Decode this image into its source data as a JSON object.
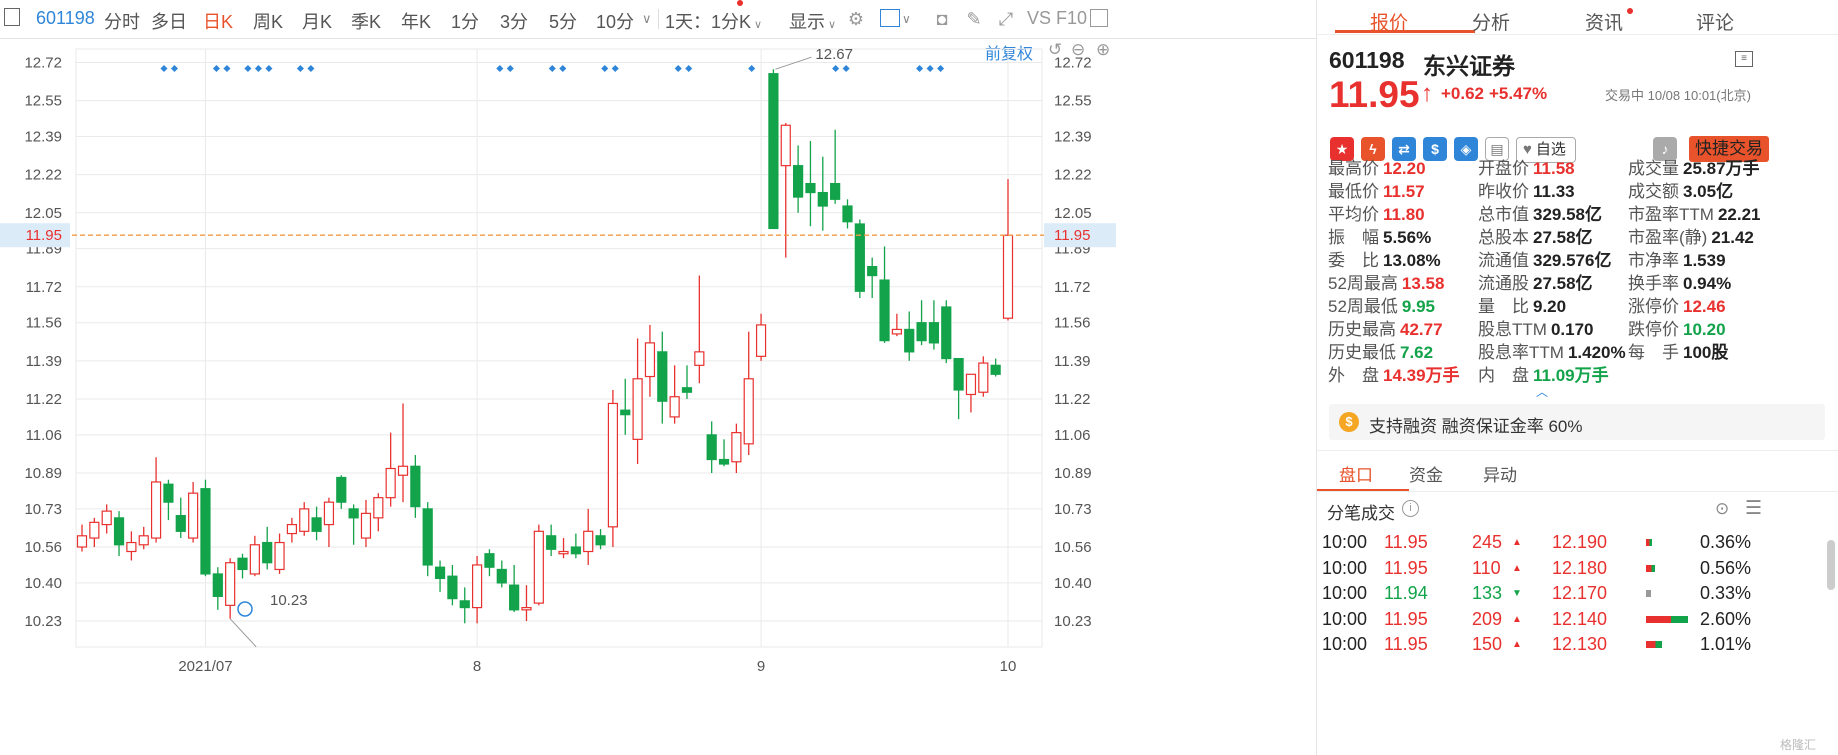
{
  "toolbar": {
    "code": "601198",
    "periods": [
      "分时",
      "多日",
      "日K",
      "周K",
      "月K",
      "季K",
      "年K",
      "1分",
      "3分",
      "5分",
      "10分"
    ],
    "active_period": "日K",
    "interval_select": "1天：1分K",
    "display_label": "显示",
    "vs_label": "VS",
    "f10_label": "F10",
    "rights_label": "前复权"
  },
  "chart": {
    "current_price_tag": "11.95",
    "high_annotation": "12.67",
    "low_annotation": "10.23",
    "y_ticks": [
      "12.72",
      "12.55",
      "12.39",
      "12.22",
      "12.05",
      "11.89",
      "11.72",
      "11.56",
      "11.39",
      "11.22",
      "11.06",
      "10.89",
      "10.73",
      "10.56",
      "10.40",
      "10.23"
    ],
    "x_labels": [
      "2021/07",
      "8",
      "9",
      "10"
    ],
    "colors": {
      "up": "#e8312e",
      "down": "#13a34a",
      "current_line": "#f39a44",
      "grid": "#eaeaea",
      "marker": "#2f86d9"
    }
  },
  "chart_data": {
    "type": "candlestick",
    "ylim": [
      10.15,
      12.78
    ],
    "candles": [
      [
        10.56,
        10.61,
        10.54,
        10.66
      ],
      [
        10.6,
        10.67,
        10.56,
        10.69
      ],
      [
        10.66,
        10.72,
        10.62,
        10.75
      ],
      [
        10.69,
        10.57,
        10.52,
        10.72
      ],
      [
        10.54,
        10.58,
        10.5,
        10.63
      ],
      [
        10.57,
        10.61,
        10.55,
        10.65
      ],
      [
        10.6,
        10.85,
        10.58,
        10.96
      ],
      [
        10.84,
        10.76,
        10.68,
        10.86
      ],
      [
        10.7,
        10.63,
        10.6,
        10.78
      ],
      [
        10.6,
        10.8,
        10.58,
        10.85
      ],
      [
        10.82,
        10.44,
        10.43,
        10.86
      ],
      [
        10.44,
        10.34,
        10.28,
        10.47
      ],
      [
        10.3,
        10.49,
        10.24,
        10.51
      ],
      [
        10.51,
        10.46,
        10.42,
        10.53
      ],
      [
        10.44,
        10.57,
        10.43,
        10.61
      ],
      [
        10.58,
        10.49,
        10.46,
        10.65
      ],
      [
        10.46,
        10.58,
        10.44,
        10.62
      ],
      [
        10.62,
        10.66,
        10.58,
        10.69
      ],
      [
        10.63,
        10.73,
        10.61,
        10.76
      ],
      [
        10.69,
        10.63,
        10.59,
        10.74
      ],
      [
        10.66,
        10.76,
        10.56,
        10.78
      ],
      [
        10.87,
        10.76,
        10.73,
        10.88
      ],
      [
        10.73,
        10.69,
        10.57,
        10.75
      ],
      [
        10.6,
        10.71,
        10.56,
        10.77
      ],
      [
        10.69,
        10.78,
        10.63,
        10.8
      ],
      [
        10.78,
        10.91,
        10.74,
        11.07
      ],
      [
        10.88,
        10.92,
        10.76,
        11.2
      ],
      [
        10.92,
        10.74,
        10.69,
        10.97
      ],
      [
        10.73,
        10.48,
        10.43,
        10.76
      ],
      [
        10.47,
        10.42,
        10.36,
        10.5
      ],
      [
        10.43,
        10.33,
        10.3,
        10.48
      ],
      [
        10.32,
        10.29,
        10.22,
        10.38
      ],
      [
        10.29,
        10.48,
        10.22,
        10.52
      ],
      [
        10.53,
        10.47,
        10.43,
        10.55
      ],
      [
        10.46,
        10.4,
        10.38,
        10.5
      ],
      [
        10.39,
        10.28,
        10.27,
        10.48
      ],
      [
        10.28,
        10.29,
        10.23,
        10.39
      ],
      [
        10.31,
        10.63,
        10.3,
        10.66
      ],
      [
        10.61,
        10.55,
        10.52,
        10.66
      ],
      [
        10.53,
        10.54,
        10.51,
        10.6
      ],
      [
        10.56,
        10.53,
        10.51,
        10.62
      ],
      [
        10.54,
        10.63,
        10.48,
        10.73
      ],
      [
        10.61,
        10.57,
        10.55,
        10.64
      ],
      [
        10.65,
        11.2,
        10.56,
        11.26
      ],
      [
        11.17,
        11.15,
        11.06,
        11.31
      ],
      [
        11.04,
        11.31,
        10.93,
        11.49
      ],
      [
        11.32,
        11.47,
        11.23,
        11.55
      ],
      [
        11.43,
        11.21,
        11.11,
        11.52
      ],
      [
        11.14,
        11.23,
        11.11,
        11.37
      ],
      [
        11.27,
        11.25,
        11.22,
        11.37
      ],
      [
        11.37,
        11.43,
        11.29,
        11.77
      ],
      [
        11.06,
        10.95,
        10.89,
        11.12
      ],
      [
        10.95,
        10.93,
        10.92,
        11.04
      ],
      [
        10.94,
        11.07,
        10.89,
        11.11
      ],
      [
        11.02,
        11.31,
        10.97,
        11.52
      ],
      [
        11.41,
        11.55,
        11.39,
        11.6
      ],
      [
        12.67,
        11.98,
        11.98,
        12.69
      ],
      [
        12.26,
        12.44,
        11.85,
        12.45
      ],
      [
        12.26,
        12.12,
        12.05,
        12.35
      ],
      [
        12.18,
        12.14,
        11.99,
        12.37
      ],
      [
        12.14,
        12.08,
        11.97,
        12.3
      ],
      [
        12.18,
        12.11,
        12.09,
        12.42
      ],
      [
        12.08,
        12.01,
        11.98,
        12.11
      ],
      [
        12.0,
        11.7,
        11.67,
        12.02
      ],
      [
        11.81,
        11.77,
        11.67,
        11.85
      ],
      [
        11.75,
        11.48,
        11.47,
        11.9
      ],
      [
        11.51,
        11.53,
        11.5,
        11.6
      ],
      [
        11.53,
        11.43,
        11.39,
        11.61
      ],
      [
        11.56,
        11.48,
        11.46,
        11.66
      ],
      [
        11.56,
        11.47,
        11.44,
        11.66
      ],
      [
        11.63,
        11.4,
        11.38,
        11.66
      ],
      [
        11.4,
        11.26,
        11.13,
        11.4
      ],
      [
        11.24,
        11.33,
        11.16,
        11.33
      ],
      [
        11.25,
        11.38,
        11.23,
        11.41
      ],
      [
        11.37,
        11.33,
        11.32,
        11.4
      ],
      [
        11.58,
        11.95,
        11.57,
        12.2
      ]
    ]
  },
  "panel": {
    "tabs": [
      "报价",
      "分析",
      "资讯",
      "评论"
    ],
    "active_tab": "报价",
    "code": "601198",
    "name": "东兴证券",
    "price": "11.95",
    "change": "+0.62",
    "change_pct": "+5.47%",
    "status": "交易中 10/08 10:01(北京)",
    "watch_label": "自选",
    "quick_trade": "快捷交易",
    "stats": [
      [
        [
          "最高价",
          "12.20",
          "red"
        ],
        [
          "开盘价",
          "11.58",
          "red"
        ],
        [
          "成交量",
          "25.87万手",
          "dark"
        ]
      ],
      [
        [
          "最低价",
          "11.57",
          "red"
        ],
        [
          "昨收价",
          "11.33",
          "dark"
        ],
        [
          "成交额",
          "3.05亿",
          "dark"
        ]
      ],
      [
        [
          "平均价",
          "11.80",
          "red"
        ],
        [
          "总市值",
          "329.58亿",
          "dark"
        ],
        [
          "市盈率TTM",
          "22.21",
          "dark"
        ]
      ],
      [
        [
          "振　幅",
          "5.56%",
          "dark"
        ],
        [
          "总股本",
          "27.58亿",
          "dark"
        ],
        [
          "市盈率(静)",
          "21.42",
          "dark"
        ]
      ],
      [
        [
          "委　比",
          "13.08%",
          "dark"
        ],
        [
          "流通值",
          "329.576亿",
          "dark"
        ],
        [
          "市净率",
          "1.539",
          "dark"
        ]
      ],
      [
        [
          "52周最高",
          "13.58",
          "red"
        ],
        [
          "流通股",
          "27.58亿",
          "dark"
        ],
        [
          "换手率",
          "0.94%",
          "dark"
        ]
      ],
      [
        [
          "52周最低",
          "9.95",
          "green"
        ],
        [
          "量　比",
          "9.20",
          "dark"
        ],
        [
          "涨停价",
          "12.46",
          "red"
        ]
      ],
      [
        [
          "历史最高",
          "42.77",
          "red"
        ],
        [
          "股息TTM",
          "0.170",
          "dark"
        ],
        [
          "跌停价",
          "10.20",
          "green"
        ]
      ],
      [
        [
          "历史最低",
          "7.62",
          "green"
        ],
        [
          "股息率TTM",
          "1.420%",
          "dark"
        ],
        [
          "每　手",
          "100股",
          "dark"
        ]
      ],
      [
        [
          "外　盘",
          "14.39万手",
          "red"
        ],
        [
          "内　盘",
          "11.09万手",
          "green"
        ],
        [
          "",
          "",
          "dark"
        ]
      ]
    ],
    "margin_note": "支持融资 融资保证金率 60%",
    "sub_tabs": [
      "盘口",
      "资金",
      "异动"
    ],
    "active_sub_tab": "盘口",
    "trades_title": "分笔成交",
    "trades": [
      {
        "time": "10:00",
        "price": "11.95",
        "vol": "245",
        "dir": "up",
        "level": "12.190",
        "pct": "0.36%"
      },
      {
        "time": "10:00",
        "price": "11.95",
        "vol": "110",
        "dir": "up",
        "level": "12.180",
        "pct": "0.56%"
      },
      {
        "time": "10:00",
        "price": "11.94",
        "vol": "133",
        "dir": "down",
        "level": "12.170",
        "pct": "0.33%"
      },
      {
        "time": "10:00",
        "price": "11.95",
        "vol": "209",
        "dir": "up",
        "level": "12.140",
        "pct": "2.60%"
      },
      {
        "time": "10:00",
        "price": "11.95",
        "vol": "150",
        "dir": "up",
        "level": "12.130",
        "pct": "1.01%"
      }
    ]
  }
}
